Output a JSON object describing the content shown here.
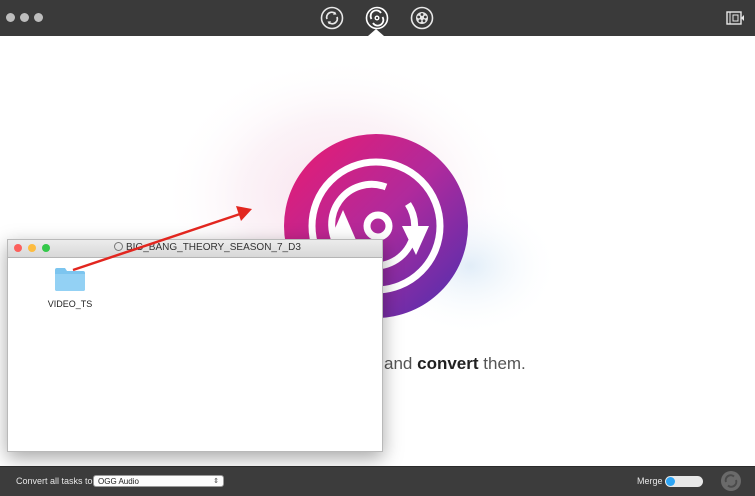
{
  "toolbar": {
    "icons": [
      "convert-icon",
      "convert-disc-icon",
      "convert-film-icon",
      "film-settings-icon"
    ]
  },
  "splash": {
    "tagline_prefix": "and",
    "tagline_bold": "convert",
    "tagline_suffix": "them."
  },
  "finder": {
    "title": "BIG_BANG_THEORY_SEASON_7_D3",
    "items": [
      {
        "name": "VIDEO_TS",
        "icon": "folder-icon"
      }
    ]
  },
  "bottom": {
    "convert_label": "Convert all tasks to",
    "format_value": "OGG Audio",
    "merge_label": "Merge"
  },
  "colors": {
    "accent_blue": "#2ea5f5",
    "brand_pink": "#e2197d",
    "brand_purple": "#5a2aa8"
  }
}
